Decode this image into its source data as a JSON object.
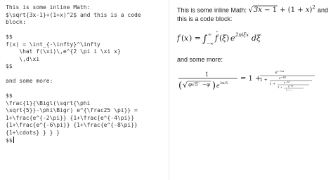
{
  "editor": {
    "lines": [
      "This is some inline Math:",
      "$\\sqrt{3x-1}+(1+x)^2$ and this is a code",
      "block:",
      "",
      "$$",
      "f(x) = \\int_{-\\infty}^\\infty",
      "    \\hat f(\\xi)\\,e^{2 \\pi i \\xi x}",
      "    \\,d\\xi",
      "$$",
      "",
      "and some more:",
      "",
      "$$",
      "\\frac{1}{\\Bigl(\\sqrt{\\phi",
      "\\sqrt{5}}-\\phi\\Bigr) e^{\\frac25 \\pi}} =",
      "1+\\frac{e^{-2\\pi}} {1+\\frac{e^{-4\\pi}}",
      "{1+\\frac{e^{-6\\pi}} {1+\\frac{e^{-8\\pi}}",
      "{1+\\cdots} } } }",
      "$$"
    ]
  },
  "preview": {
    "para1_text": "This is some inline Math:",
    "para1_math": "√(3x − 1) + (1 + x)²",
    "para1_tail": "and this is a code block:",
    "equation1": "f(x) = ∫₋∞^∞ f̂(ξ) e^{2πiξx} dξ",
    "para2": "and some more:",
    "equation2": "1 / ((√(φ√5) − φ) e^{2π/5}) = 1 + e^{−2π} / (1 + e^{−4π} / (1 + e^{−6π} / (1 + e^{−8π} / (1 + ⋯))))"
  }
}
